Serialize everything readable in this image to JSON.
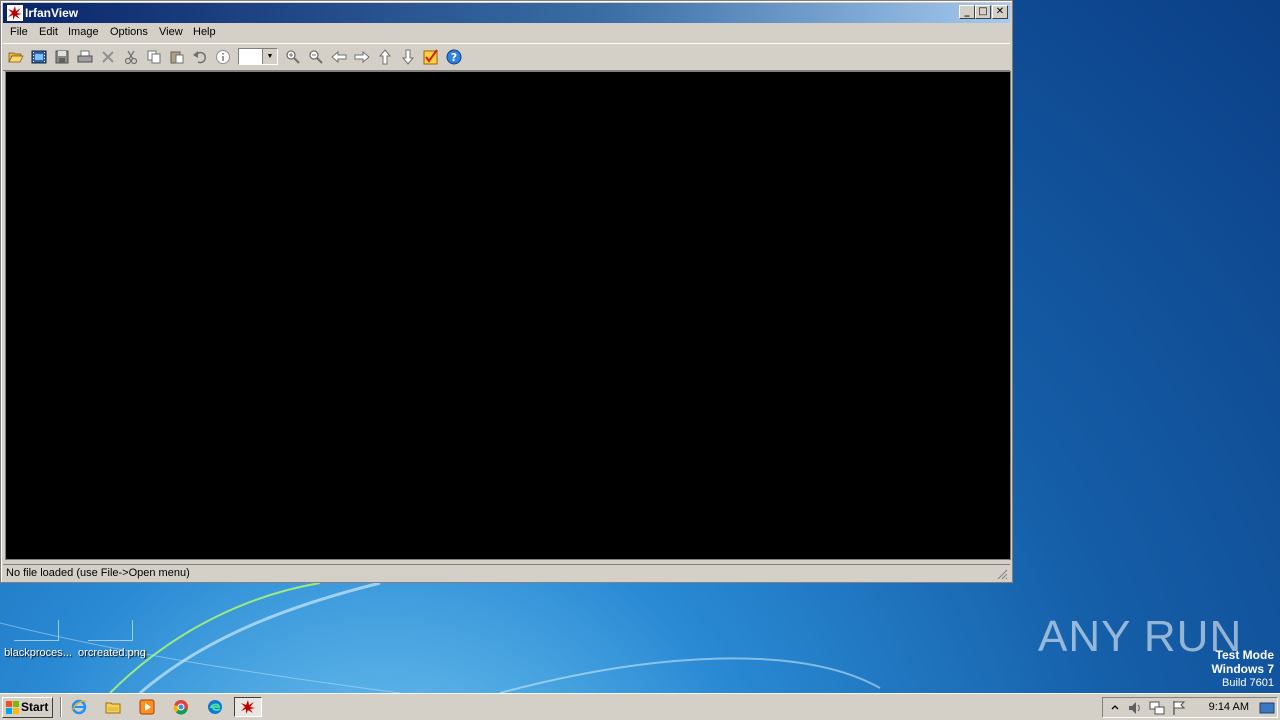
{
  "window": {
    "title": "IrfanView",
    "menu": [
      "File",
      "Edit",
      "Image",
      "Options",
      "View",
      "Help"
    ],
    "toolbar_icons": [
      "open-icon",
      "slideshow-icon",
      "save-icon",
      "print-icon",
      "delete-icon",
      "cut-icon",
      "copy-icon",
      "paste-icon",
      "undo-icon",
      "info-icon",
      "zoom-combo",
      "zoom-in-icon",
      "zoom-out-icon",
      "previous-icon",
      "next-icon",
      "first-icon",
      "last-icon",
      "thumbnails-icon",
      "help-icon"
    ],
    "zoom_value": "",
    "status_text": "No file loaded (use File->Open menu)"
  },
  "desktop": {
    "icons": [
      {
        "label": "blackproces..."
      },
      {
        "label": "orcreated.png"
      }
    ],
    "watermark": "ANY RUN",
    "test_mode": {
      "line1": "Test Mode",
      "line2": "Windows 7",
      "line3": "Build 7601"
    }
  },
  "taskbar": {
    "start_label": "Start",
    "quick_launch": [
      "internet-explorer-icon",
      "explorer-icon",
      "media-player-icon",
      "chrome-icon",
      "edge-icon",
      "irfanview-icon"
    ],
    "clock": "9:14 AM"
  },
  "colors": {
    "title_start": "#0a246a",
    "title_end": "#a6caf0",
    "face": "#d4d0c8",
    "canvas": "#000000"
  }
}
